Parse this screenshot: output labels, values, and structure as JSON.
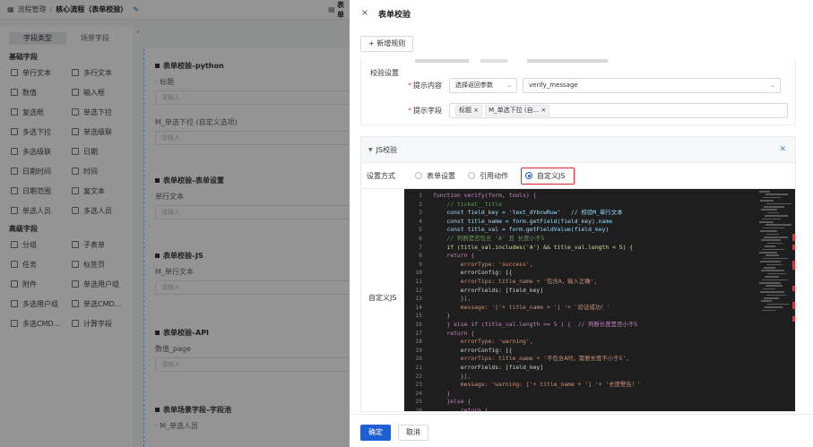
{
  "topbar": {
    "crumb1": "流程管理",
    "crumb2": "核心流程（表单校验）",
    "edit_icon": "✎",
    "right_text": "表单"
  },
  "left_panel": {
    "tabs": [
      "字段类型",
      "场景字段"
    ],
    "basic_title": "基础字段",
    "basic_items": [
      "单行文本",
      "多行文本",
      "数值",
      "输入框",
      "复选框",
      "单选下拉",
      "多选下拉",
      "单选级联",
      "多选级联",
      "日期",
      "日期时间",
      "时间",
      "日期范围",
      "富文本",
      "单选人员",
      "多选人员"
    ],
    "advanced_title": "高级字段",
    "advanced_items": [
      "分组",
      "子表单",
      "任务",
      "标签页",
      "附件",
      "单选用户组",
      "多选用户组",
      "单选CMD...",
      "多选CMD...",
      "计算字段"
    ]
  },
  "canvas": {
    "blocks": [
      {
        "title": "表单校验–python",
        "label1": "· 标题",
        "input1": "请输入",
        "label2": "M_单选下拉 (自定义选项)",
        "input2": "请输入"
      },
      {
        "title": "表单校验–表单设置",
        "label1": "单行文本",
        "input1": "请输入"
      },
      {
        "title": "表单校验–JS",
        "label1": "M_单行文本",
        "input1": "请输入"
      },
      {
        "title": "表单校验–API",
        "label1": "数值_page",
        "input1": "请输入"
      },
      {
        "title": "表单场景字段–字段池",
        "label1": "· M_单选人员",
        "input1": ""
      }
    ]
  },
  "drawer": {
    "close": "×",
    "title": "表单校验",
    "add_rule": "+ 新增规则",
    "validate_settings": {
      "label": "校验设置",
      "hint_content_label": "提示内容",
      "hint_content_select": "选择返回参数",
      "hint_content_value": "verify_message",
      "hint_field_label": "提示字段",
      "hint_field_tags": [
        "标题",
        "M_单选下拉 (自..."
      ]
    },
    "js_section": {
      "title": "JS校验",
      "mode_label": "设置方式",
      "options": [
        "表单设置",
        "引用动作",
        "自定义JS"
      ],
      "selected": "自定义JS",
      "custom_label": "自定义JS"
    },
    "code_lines": [
      "function verify(form, tools) {",
      "    // ticket__title",
      "    const field_key = 'text_dYbcwRuw'   // 校验M_单行文本",
      "    const title_name = form.getField(field_key).name",
      "    const title_val = form.getFieldValue(field_key)",
      "    // 判断是否包含 'A' 且 长度小于5",
      "    if (title_val.includes('A') && title_val.length < 5) {",
      "    return {",
      "        errorType: 'success',",
      "        errorConfig: [{",
      "        errorTips: title_name + '包含A，输入正确',",
      "        errorFields: [field_key]",
      "        }],",
      "        message: '['+ title_name + '] '+ '验证成功！'",
      "    }",
      "    } else if (title_val.length >= 5 ) {  // 判断长度是否小于5",
      "    return {",
      "        errorType: 'warning',",
      "        errorConfig: [{",
      "        errorTips: title_name + '不包含A时，需要长度不小于5',",
      "        errorFields: [field_key]",
      "        }],",
      "        message: 'warning: ['+ title_name + '] '+ '长度警告！'",
      "    }",
      "    }else {",
      "        return {"
    ],
    "footer": {
      "ok": "确定",
      "cancel": "取消"
    }
  },
  "colors": {
    "primary": "#1f5fd4",
    "highlight": "#d9242b",
    "editor_bg": "#1e1e1e"
  }
}
